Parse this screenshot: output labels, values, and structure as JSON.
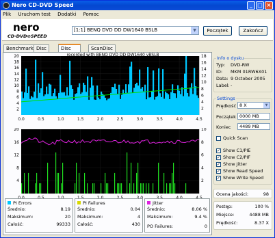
{
  "window": {
    "title": "Nero CD-DVD Speed"
  },
  "menu": [
    "Plik",
    "Uruchom test",
    "Dodatki",
    "Pomoc"
  ],
  "header": {
    "drive": "[1:1]  BENQ DVD DD DW1640 BSLB",
    "start_button": "Początek",
    "close_button": "Zakończ"
  },
  "tabs": [
    "Benchmark",
    "Disc Info",
    "Disc Quality",
    "ScanDisc"
  ],
  "chart_top": {
    "caption": "recorded with BENQ    DVD DD DW1640   vBSLB",
    "left_ticks": [
      "20",
      "18",
      "16",
      "14",
      "12",
      "10",
      "8",
      "6",
      "4",
      "2"
    ],
    "right_ticks": [
      "18",
      "16",
      "14",
      "12",
      "10",
      "8",
      "6",
      "4",
      "2"
    ],
    "x_ticks": [
      "0.0",
      "0.5",
      "1.0",
      "1.5",
      "2.0",
      "2.5",
      "3.0",
      "3.5",
      "4.0",
      "4.5"
    ]
  },
  "chart_bottom": {
    "left_ticks": [
      "20",
      "16",
      "12",
      "8",
      "4"
    ],
    "right_ticks": [
      "10",
      "8",
      "6",
      "4",
      "2"
    ],
    "x_ticks": [
      "0.0",
      "0.5",
      "1.0",
      "1.5",
      "2.0",
      "2.5",
      "3.0",
      "3.5",
      "4.0",
      "4.5"
    ]
  },
  "chart_data": [
    {
      "type": "bar",
      "series": [
        {
          "name": "PI Errors",
          "description": "dense PI error bars, mostly 5–12 per sample, peaks up to 20"
        },
        {
          "name": "Read speed",
          "description": "rising from ~4 to ~8.4 over 0–4.5 GB"
        }
      ],
      "xlim": [
        0,
        4.5
      ],
      "ylim": [
        0,
        20
      ],
      "y2lim": [
        0,
        18
      ]
    },
    {
      "type": "bar",
      "series": [
        {
          "name": "PI Failures",
          "description": "sparse green spikes, max 4"
        },
        {
          "name": "Jitter",
          "description": "roughly flat ~8–9%"
        }
      ],
      "xlim": [
        0,
        4.5
      ],
      "ylim": [
        0,
        20
      ],
      "y2lim": [
        0,
        10
      ]
    }
  ],
  "disc_info": {
    "group_label": "Info o dysku",
    "rows": [
      {
        "label": "Typ:",
        "value": "DVD-RW"
      },
      {
        "label": "ID:",
        "value": "MKM 01RW6X01"
      },
      {
        "label": "Data:",
        "value": "9 October 2005"
      },
      {
        "label": "Label:",
        "value": "-"
      }
    ]
  },
  "settings": {
    "group_label": "Settings",
    "speed_label": "Prędkość",
    "speed_value": "8 X",
    "start_label": "Początek",
    "start_value": "0000 MB",
    "end_label": "Koniec",
    "end_value": "4489 MB",
    "quick_scan": "Quick Scan",
    "checks": [
      {
        "label": "Show C1/PIE",
        "checked": true
      },
      {
        "label": "Show C2/PIF",
        "checked": true
      },
      {
        "label": "Show Jitter",
        "checked": true
      },
      {
        "label": "Show Read Speed",
        "checked": true
      },
      {
        "label": "Show Write Speed",
        "checked": true
      }
    ]
  },
  "quality": {
    "label": "Ocena jakości:",
    "value": "98"
  },
  "progress": {
    "rows": [
      {
        "label": "Postęp:",
        "value": "100 %"
      },
      {
        "label": "Miejsce:",
        "value": "4488 MB"
      },
      {
        "label": "Prędkość:",
        "value": "8.37 X"
      }
    ]
  },
  "pi_errors": {
    "title": "PI Errors",
    "color": "#00c8ff",
    "rows": [
      {
        "label": "Średnio:",
        "value": "8.19"
      },
      {
        "label": "Maksimum:",
        "value": "20"
      },
      {
        "label": "Całość:",
        "value": "99333"
      }
    ]
  },
  "pi_failures": {
    "title": "PI Failures",
    "color": "#d8d800",
    "rows": [
      {
        "label": "Średnio:",
        "value": "0.04"
      },
      {
        "label": "Maksimum:",
        "value": "4"
      },
      {
        "label": "Całość:",
        "value": "430"
      }
    ]
  },
  "jitter": {
    "title": "Jitter",
    "color": "#e020e0",
    "rows": [
      {
        "label": "Średnio:",
        "value": "8.06 %"
      },
      {
        "label": "Maksimum:",
        "value": "9.4 %"
      }
    ],
    "po_label": "PO Failures:",
    "po_value": "0"
  }
}
